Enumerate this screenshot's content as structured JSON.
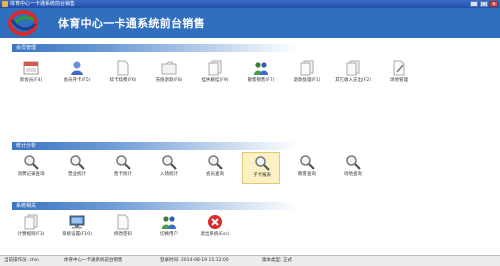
{
  "window": {
    "title": "体育中心一卡通系统前台销售",
    "buttons": [
      "_",
      "□",
      "x"
    ]
  },
  "header": {
    "app_name": "体育中心一卡通系统前台销售"
  },
  "sections": [
    {
      "title": "会员管理",
      "items": [
        {
          "label": "新会员(F4)",
          "icon": "calendar-icon"
        },
        {
          "label": "会员开卡(F5)",
          "icon": "person-icon"
        },
        {
          "label": "续卡续费(F6)",
          "icon": "blank-page-icon"
        },
        {
          "label": "充值退款(F8)",
          "icon": "folder-icon"
        },
        {
          "label": "挂失解挂(F9)",
          "icon": "pages-icon"
        },
        {
          "label": "散客销售(F7)",
          "icon": "group-icon"
        },
        {
          "label": "退款处理(F1)",
          "icon": "pages-icon"
        },
        {
          "label": "其它收入支出(F2)",
          "icon": "pages-icon"
        },
        {
          "label": "场地管理",
          "icon": "edit-page-icon"
        }
      ]
    },
    {
      "title": "统计分析",
      "items": [
        {
          "label": "消费记录查询",
          "icon": "magnifier-icon"
        },
        {
          "label": "营业统计",
          "icon": "magnifier-icon"
        },
        {
          "label": "售卡统计",
          "icon": "magnifier-icon"
        },
        {
          "label": "入场统计",
          "icon": "magnifier-icon"
        },
        {
          "label": "会员查询",
          "icon": "magnifier-icon"
        },
        {
          "label": "子卡报表",
          "icon": "magnifier-icon",
          "selected": true
        },
        {
          "label": "散客查询",
          "icon": "magnifier-icon"
        },
        {
          "label": "场地查询",
          "icon": "magnifier-icon"
        }
      ]
    },
    {
      "title": "系统相关",
      "items": [
        {
          "label": "计费规则(F3)",
          "icon": "pages-icon"
        },
        {
          "label": "系统设置(F10)",
          "icon": "monitor-icon"
        },
        {
          "label": "修改密码",
          "icon": "blank-page-icon"
        },
        {
          "label": "切换用户",
          "icon": "group-icon"
        },
        {
          "label": "退出系统(Esc)",
          "icon": "exit-icon"
        }
      ]
    }
  ],
  "status": {
    "operator": "当前操作员: chin",
    "system": "体育中心一卡通系统前台销售",
    "login_time": "登录时间: 2014-08-19 15:12:00",
    "version": "版本类型: 正式"
  },
  "colors": {
    "header": "#2f6fbe",
    "section_bar": "#3a74c2",
    "selected_tile": "#fbf1c5",
    "exit_red": "#d92b2b"
  }
}
